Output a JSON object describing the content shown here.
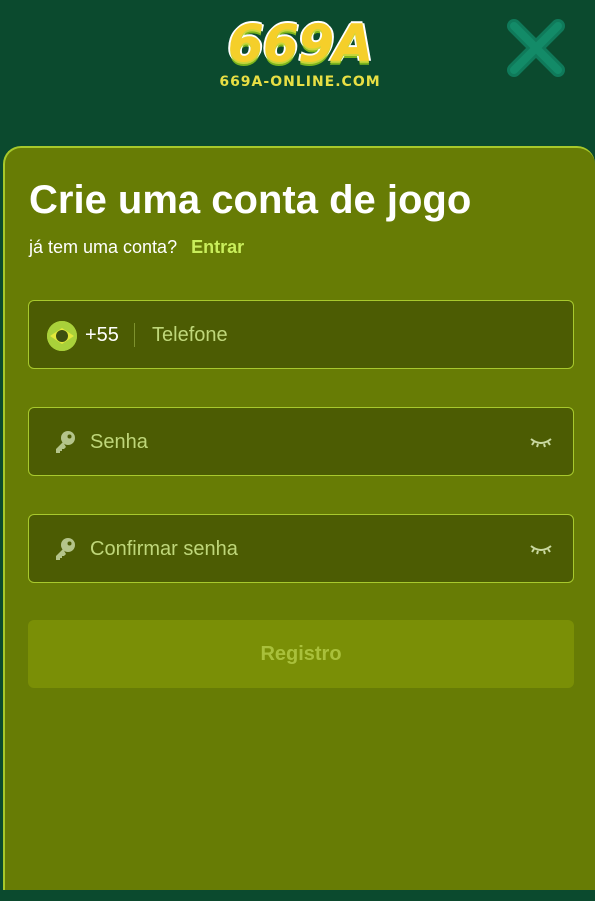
{
  "header": {
    "logo_text": "669A",
    "logo_subtext": "669A-ONLINE.COM",
    "close_icon": "close-icon"
  },
  "form": {
    "title": "Crie uma conta de jogo",
    "have_account_text": "já tem uma conta?",
    "login_link_label": "Entrar",
    "phone": {
      "flag_icon": "brazil-flag-icon",
      "country_code": "+55",
      "placeholder": "Telefone",
      "value": ""
    },
    "password": {
      "icon": "key-icon",
      "placeholder": "Senha",
      "value": "",
      "toggle_icon": "eye-closed-icon"
    },
    "confirm_password": {
      "icon": "key-icon",
      "placeholder": "Confirmar senha",
      "value": "",
      "toggle_icon": "eye-closed-icon"
    },
    "register_button_label": "Registro"
  },
  "colors": {
    "header_bg": "#0b4a2e",
    "panel_bg": "#677c05",
    "field_bg": "#4c5c03",
    "accent": "#c9ee5b",
    "button_bg": "#7a8f06"
  }
}
